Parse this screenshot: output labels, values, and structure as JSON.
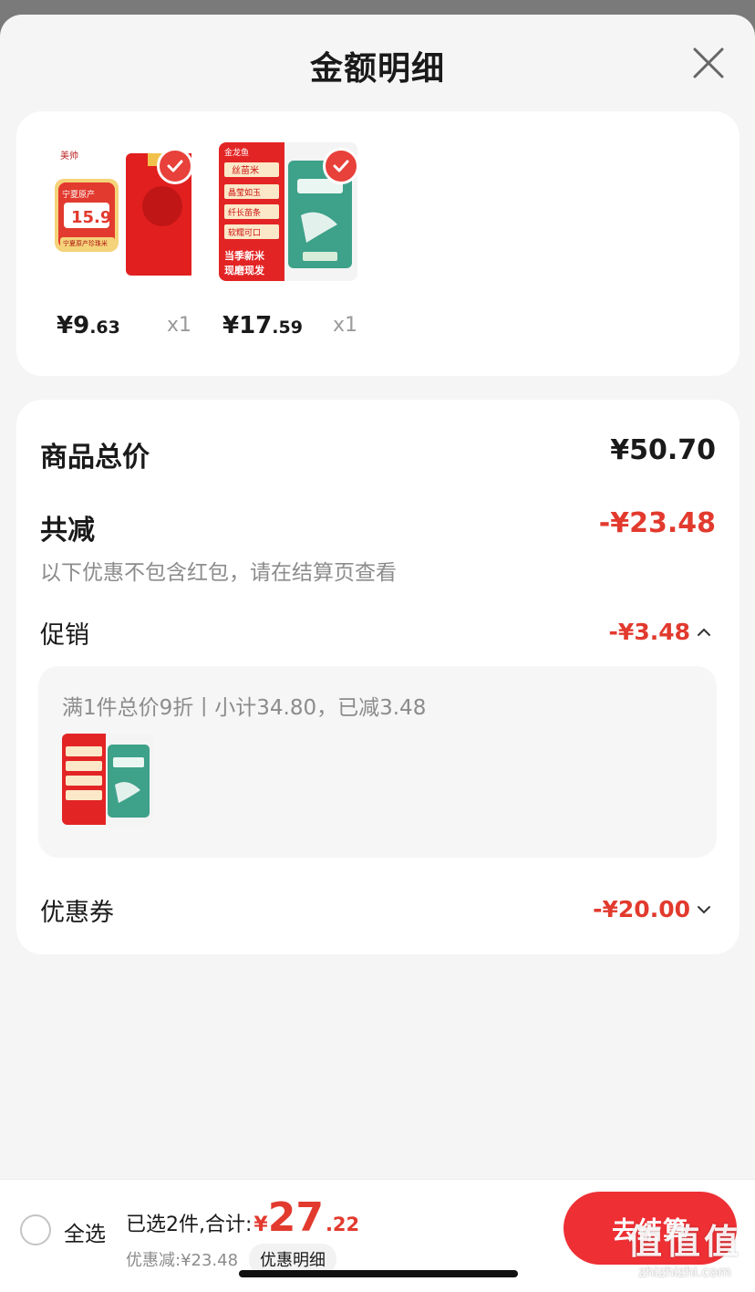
{
  "sheet": {
    "title": "金额明细"
  },
  "products": [
    {
      "price_int": "¥9",
      "price_dec": ".63",
      "qty": "x1",
      "image": {
        "brand_text": "美帅",
        "tag_text": "宁夏原产",
        "price_badge": "15.9",
        "footer_text": "宁夏原产珍珠米",
        "selected": true
      }
    },
    {
      "price_int": "¥17",
      "price_dec": ".59",
      "qty": "x1",
      "image": {
        "brand_text": "金龙鱼",
        "labels": [
          "丝苗米",
          "晶莹如玉",
          "纤长苗条",
          "软糯可口"
        ],
        "banner_line1": "当季新米",
        "banner_line2": "现磨现发",
        "selected": true
      }
    }
  ],
  "summary": {
    "total_label": "商品总价",
    "total_value": "¥50.70",
    "reduce_label": "共减",
    "reduce_value": "-¥23.48",
    "reduce_note": "以下优惠不包含红包，请在结算页查看",
    "promo_label": "促销",
    "promo_value": "-¥3.48",
    "promo_detail": "满1件总价9折丨小计34.80，已减3.48",
    "coupon_label": "优惠券",
    "coupon_value": "-¥20.00"
  },
  "bottom_bar": {
    "select_all": "全选",
    "selected_text": "已选2件,合计:",
    "total_yen": "¥",
    "total_int": "27",
    "total_dec": ".22",
    "discount_text": "优惠减:¥23.48",
    "detail_button": "优惠明细",
    "checkout_button": "去结算"
  },
  "watermark": {
    "logo": "值值值",
    "url": "zhizhizhi.com"
  },
  "colors": {
    "accent_red": "#e23a2e",
    "checkout_red": "#ee2f34",
    "background": "#f5f5f5"
  }
}
